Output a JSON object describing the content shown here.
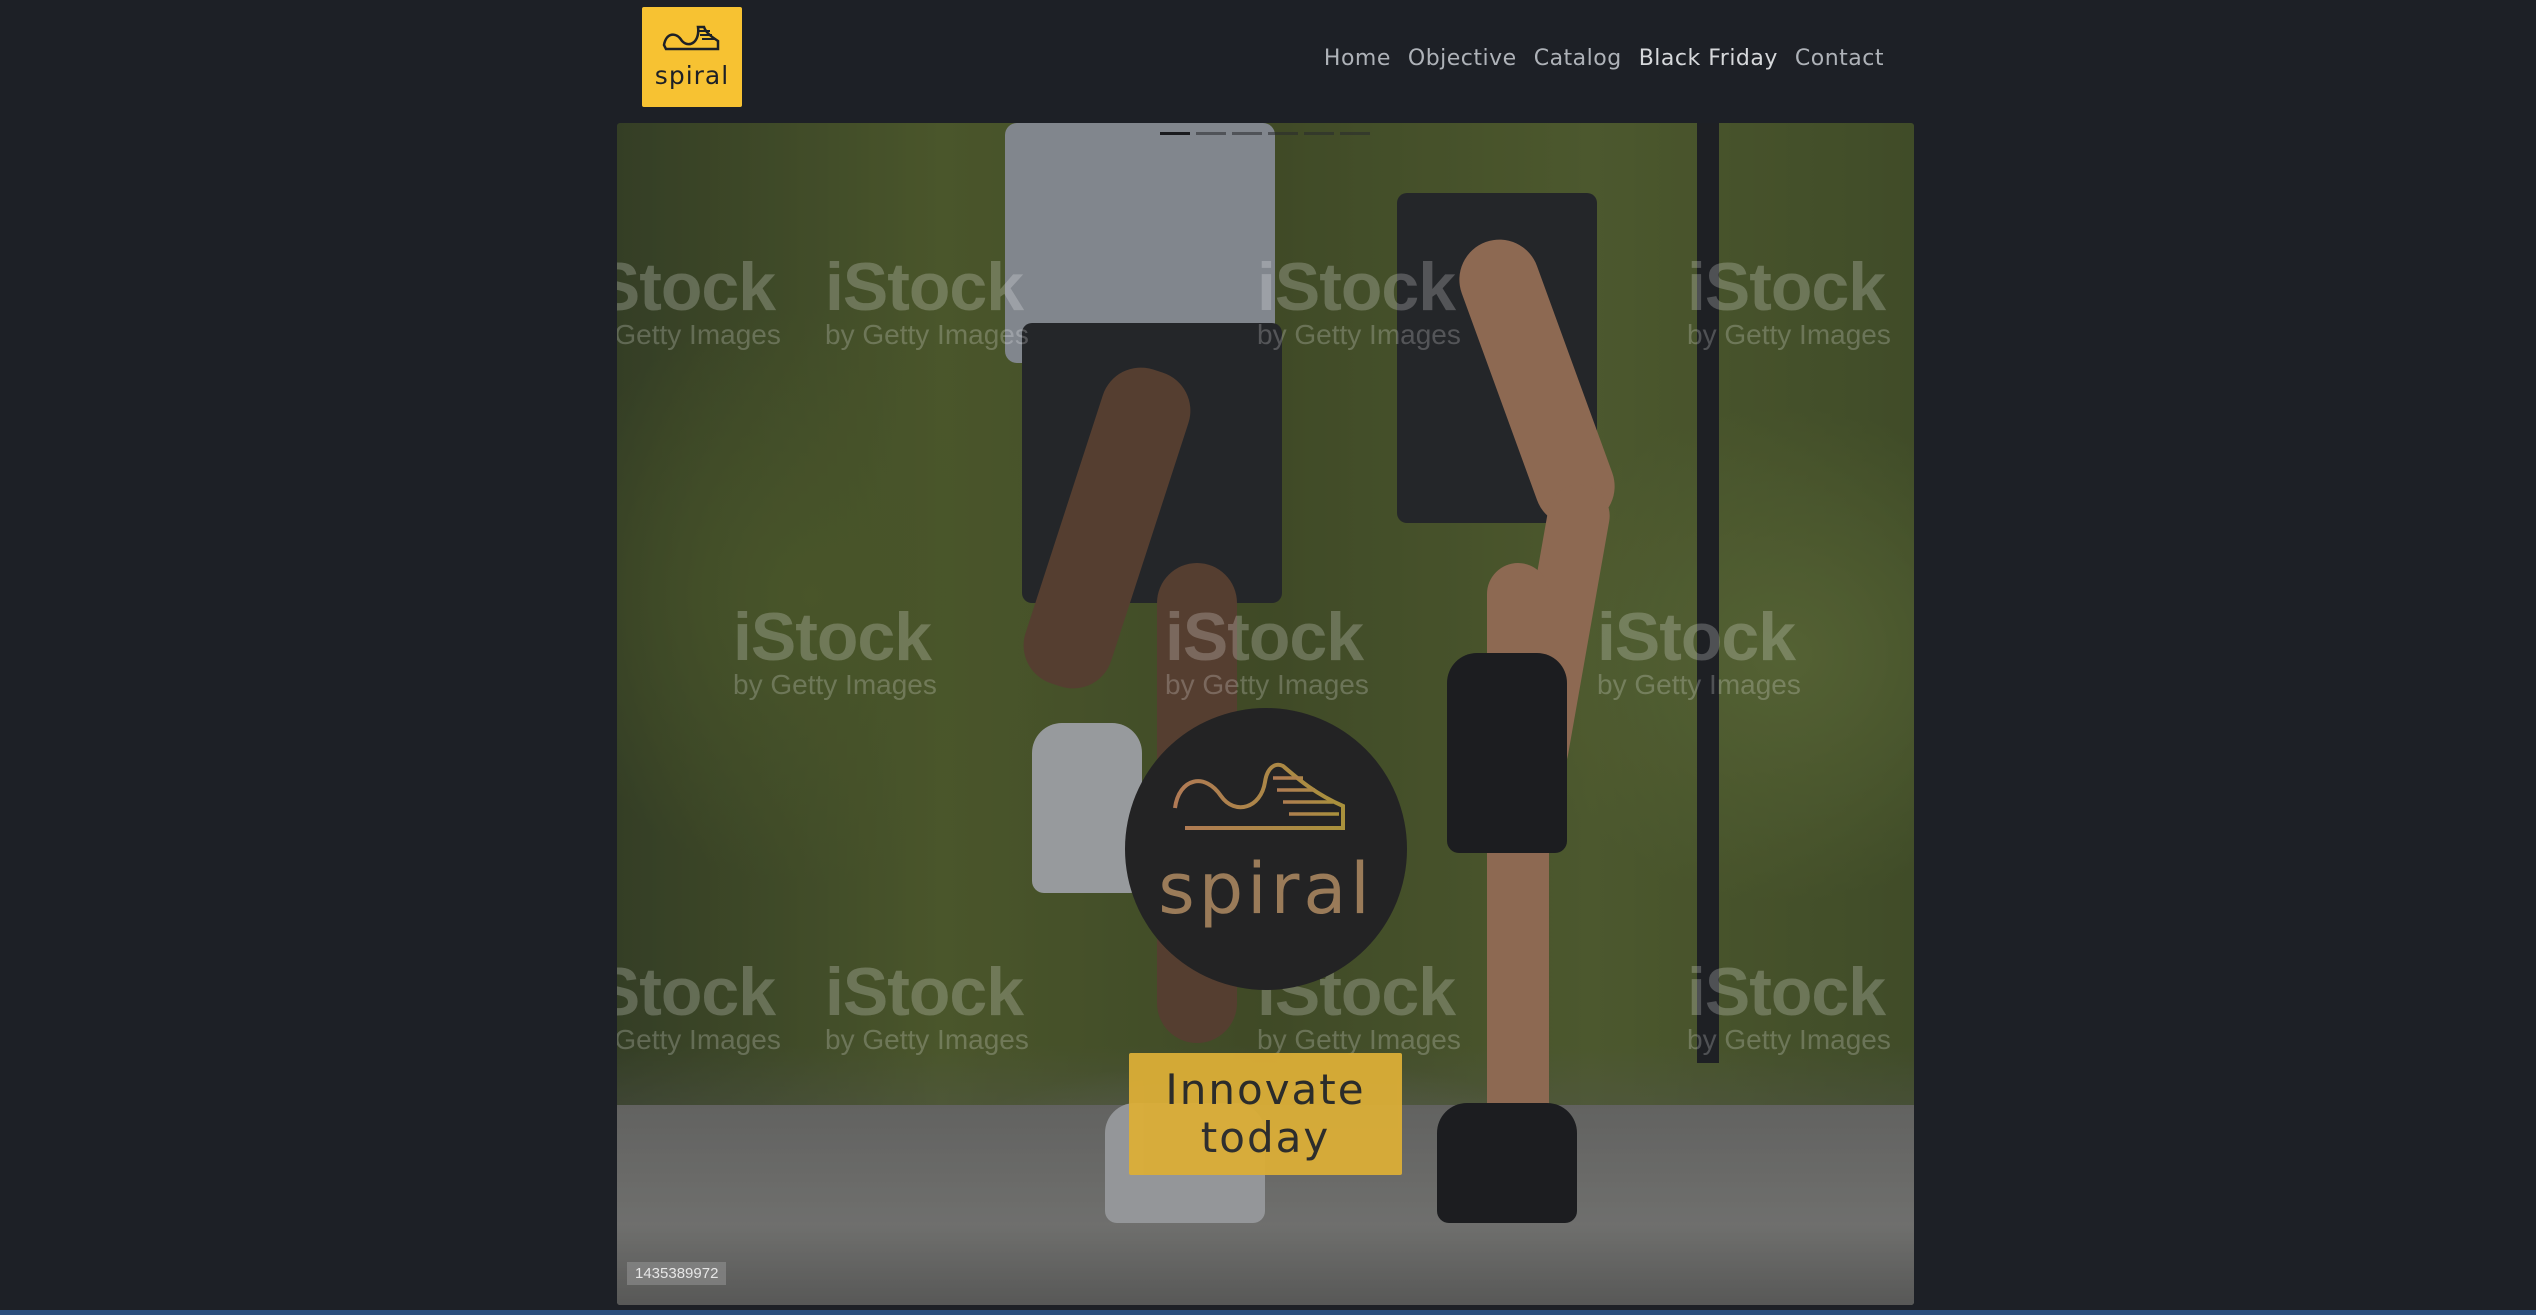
{
  "header": {
    "logo_text": "spiral",
    "nav": [
      {
        "label": "Home"
      },
      {
        "label": "Objective"
      },
      {
        "label": "Catalog"
      },
      {
        "label": "Black Friday"
      },
      {
        "label": "Contact"
      }
    ]
  },
  "hero": {
    "slides_count": 6,
    "active_slide": 1,
    "emblem_text": "spiral",
    "cta_label": "Innovate today",
    "watermark_brand": "iStock",
    "watermark_sub": "by Getty Images",
    "stock_id": "1435389972"
  },
  "colors": {
    "background": "#1d2026",
    "accent": "#f7c232",
    "cta": "#dbae37"
  }
}
